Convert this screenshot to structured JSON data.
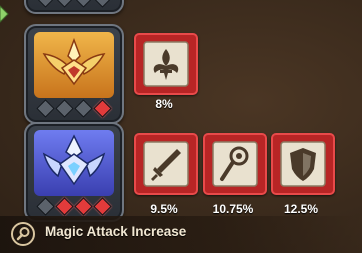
{
  "skills": [
    {
      "tier": "gold",
      "pips": [
        "off",
        "off",
        "off",
        "on"
      ],
      "bonuses": [
        {
          "icon": "fleur-de-lis-icon",
          "value": "8%"
        }
      ]
    },
    {
      "tier": "blue",
      "pips": [
        "off",
        "on",
        "on",
        "on"
      ],
      "bonuses": [
        {
          "icon": "sword-icon",
          "value": "9.5%"
        },
        {
          "icon": "magic-staff-icon",
          "value": "10.75%"
        },
        {
          "icon": "shield-icon",
          "value": "12.5%"
        }
      ]
    }
  ],
  "tooltip": {
    "icon": "magnifier-icon",
    "label": "Magic Attack Increase"
  },
  "colors": {
    "bonus_box": "#b82525",
    "pip_on": "#e23b3b",
    "gold_emblem": "#e8a531",
    "blue_emblem": "#4f63d8"
  }
}
